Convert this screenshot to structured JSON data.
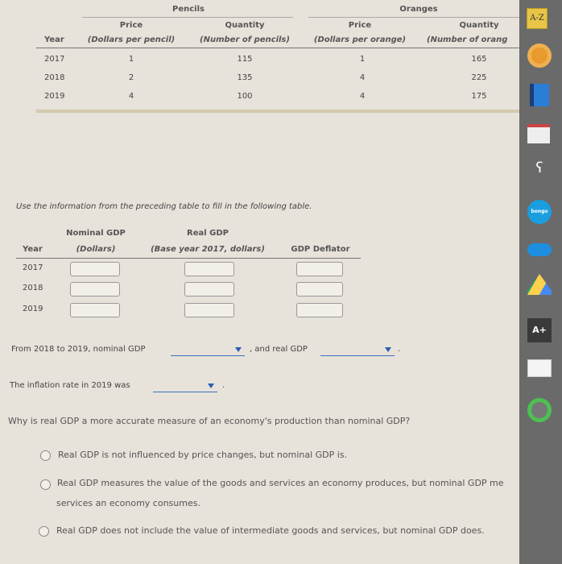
{
  "top_table": {
    "groups": [
      "Pencils",
      "Oranges"
    ],
    "year_header": "Year",
    "columns": [
      {
        "title": "Price",
        "unit": "(Dollars per pencil)"
      },
      {
        "title": "Quantity",
        "unit": "(Number of pencils)"
      },
      {
        "title": "Price",
        "unit": "(Dollars per orange)"
      },
      {
        "title": "Quantity",
        "unit": "(Number of orang"
      }
    ],
    "rows": [
      {
        "year": "2017",
        "values": [
          "1",
          "115",
          "1",
          "165"
        ]
      },
      {
        "year": "2018",
        "values": [
          "2",
          "135",
          "4",
          "225"
        ]
      },
      {
        "year": "2019",
        "values": [
          "4",
          "100",
          "4",
          "175"
        ]
      }
    ]
  },
  "instructions": "Use the information from the preceding table to fill in the following table.",
  "gdp_table": {
    "year_header": "Year",
    "nominal": {
      "title": "Nominal GDP",
      "unit": "(Dollars)"
    },
    "real": {
      "title": "Real GDP",
      "unit": "(Base year 2017, dollars)"
    },
    "deflator": {
      "title": "GDP Deflator"
    },
    "years": [
      "2017",
      "2018",
      "2019"
    ]
  },
  "sentence1": {
    "part1": "From 2018 to 2019, nominal GDP",
    "part2": ", and real GDP",
    "end": "."
  },
  "sentence2": {
    "part1": "The inflation rate in 2019 was",
    "end": "."
  },
  "question": {
    "text": "Why is real GDP a more accurate measure of an economy's production than nominal GDP?",
    "options": [
      "Real GDP is not influenced by price changes, but nominal GDP is.",
      "Real GDP measures the value of the goods and services an economy produces, but nominal GDP me",
      "services an economy consumes.",
      "Real GDP does not include the value of intermediate goods and services, but nominal GDP does."
    ]
  },
  "sidebar": {
    "icons": [
      "a-z-icon",
      "orange-disc-icon",
      "book-icon",
      "notepad-icon",
      "speech-icon",
      "bongo-icon",
      "onedrive-icon",
      "google-drive-icon",
      "a-plus-icon",
      "papers-icon",
      "green-user-icon"
    ],
    "az_label": "A-Z",
    "bongo_label": "bongo",
    "aplus_label": "A+"
  },
  "colors": {
    "background": "#e7e2da",
    "sidebar": "#6a6a6a",
    "dropdown": "#3a6fc0"
  }
}
